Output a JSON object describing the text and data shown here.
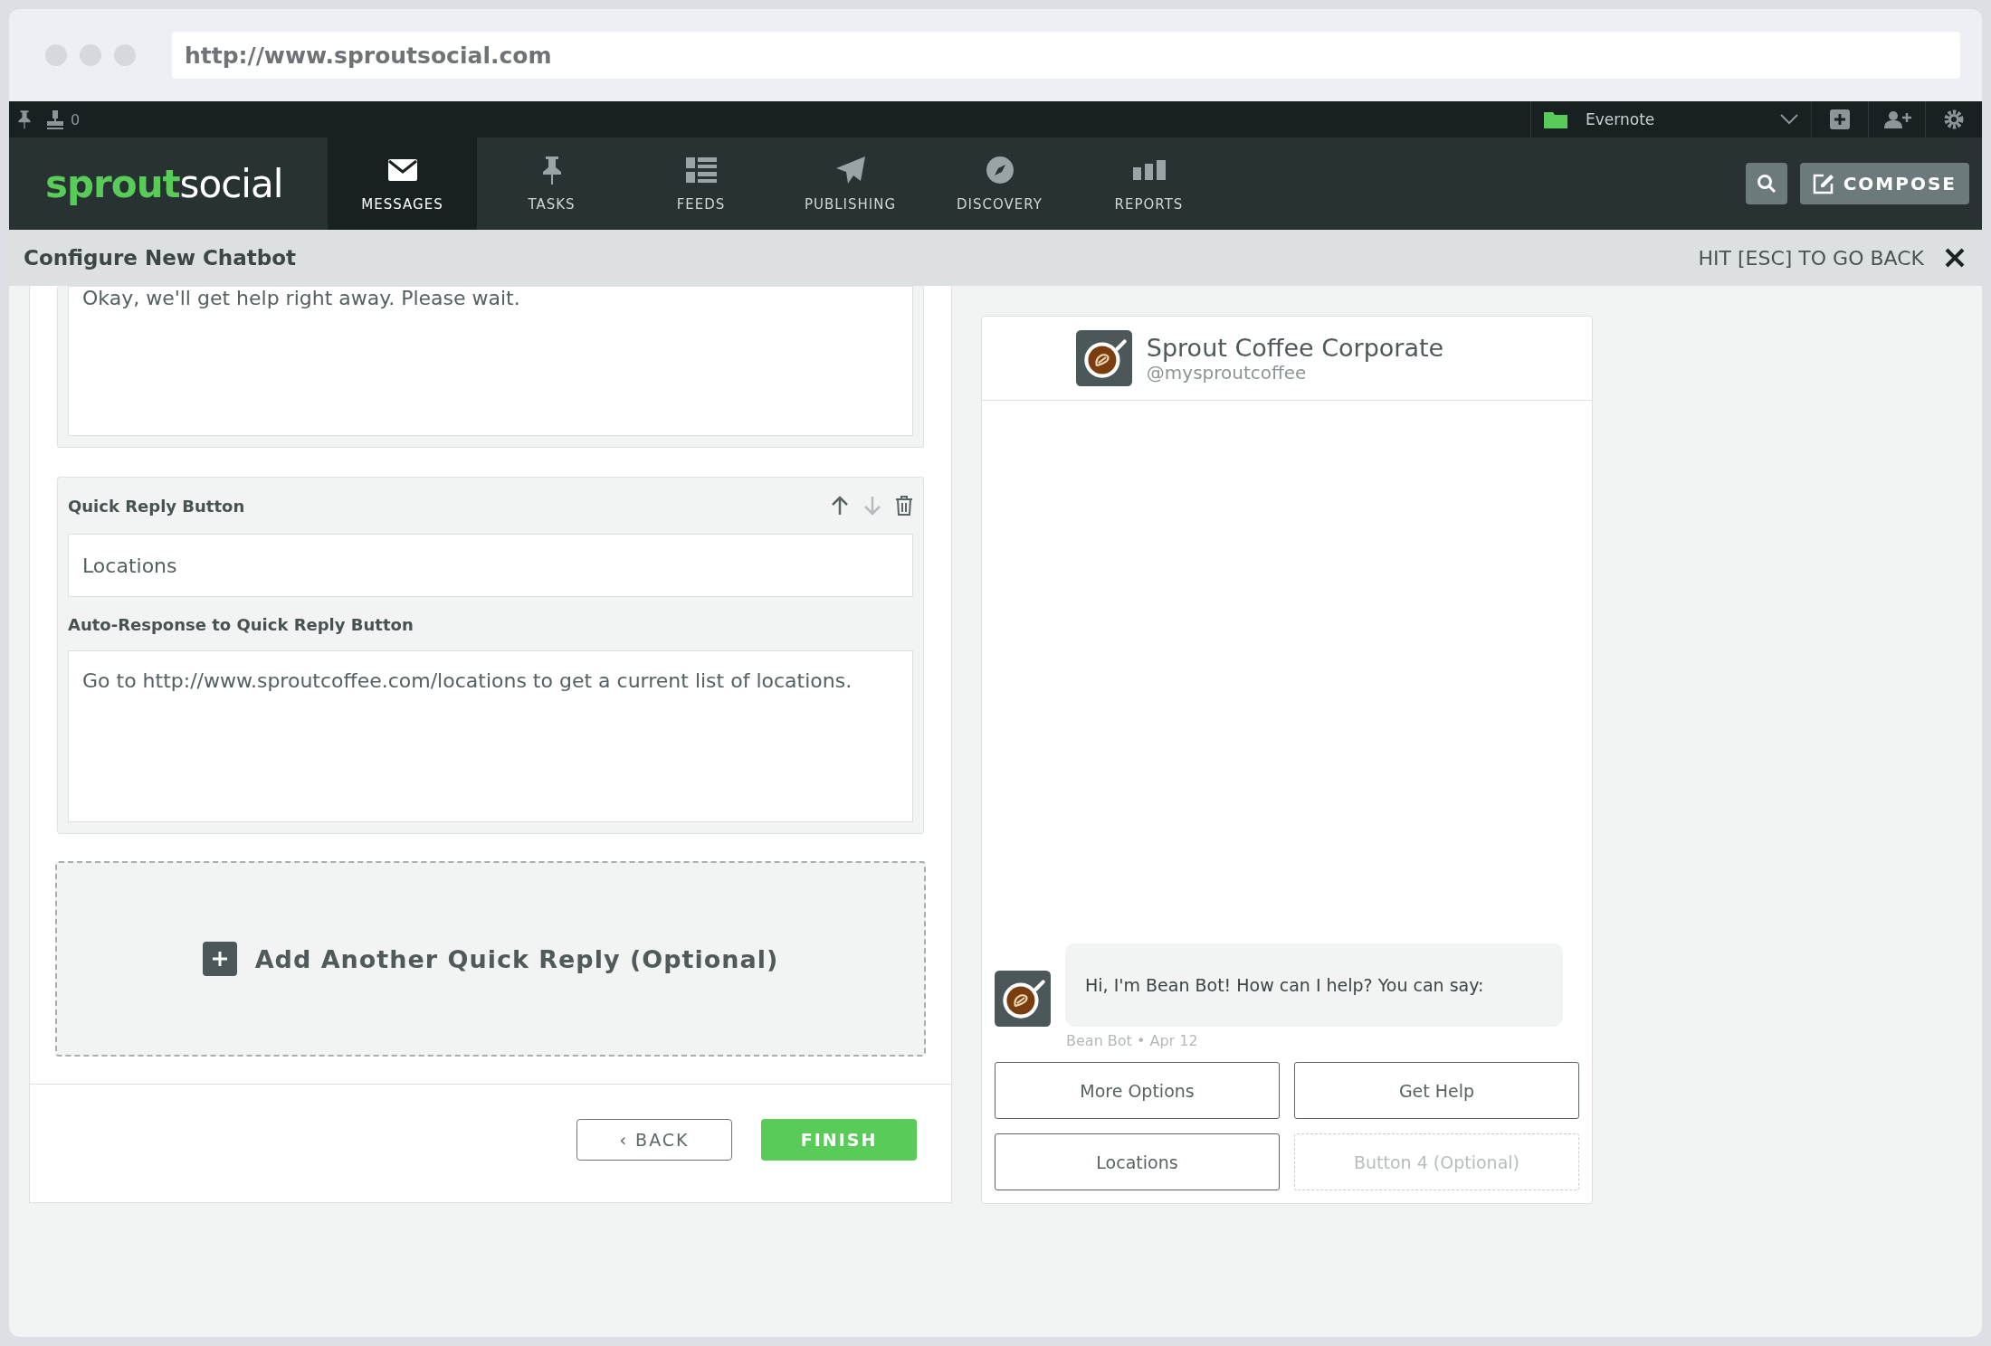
{
  "browser": {
    "url": "http://www.sproutsocial.com"
  },
  "topbar": {
    "count": "0",
    "account": "Evernote"
  },
  "nav": {
    "logo": [
      "sprout",
      "social"
    ],
    "items": [
      {
        "label": "MESSAGES",
        "selected": true
      },
      {
        "label": "TASKS",
        "selected": false
      },
      {
        "label": "FEEDS",
        "selected": false
      },
      {
        "label": "PUBLISHING",
        "selected": false
      },
      {
        "label": "DISCOVERY",
        "selected": false
      },
      {
        "label": "REPORTS",
        "selected": false
      }
    ],
    "compose": "COMPOSE"
  },
  "header": {
    "title": "Configure New Chatbot",
    "hint": "HIT [ESC] TO GO BACK"
  },
  "editor": {
    "previous_response": "Okay, we'll get help right away. Please wait.",
    "quick_reply": {
      "title": "Quick Reply Button",
      "button_value": "Locations",
      "response_label": "Auto-Response to Quick Reply Button",
      "response_value": "Go to http://www.sproutcoffee.com/locations to get a current list of locations."
    },
    "add_label": "Add Another Quick Reply (Optional)",
    "back": "‹ BACK",
    "finish": "FINISH"
  },
  "preview": {
    "name": "Sprout Coffee Corporate",
    "handle": "@mysproutcoffee",
    "message": "Hi, I'm Bean Bot! How can I help? You can say:",
    "meta": "Bean Bot • Apr 12",
    "buttons": [
      {
        "label": "More Options",
        "kind": "set"
      },
      {
        "label": "Get Help",
        "kind": "set"
      },
      {
        "label": "Locations",
        "kind": "set"
      },
      {
        "label": "Button 4 (Optional)",
        "kind": "placeholder"
      }
    ]
  }
}
